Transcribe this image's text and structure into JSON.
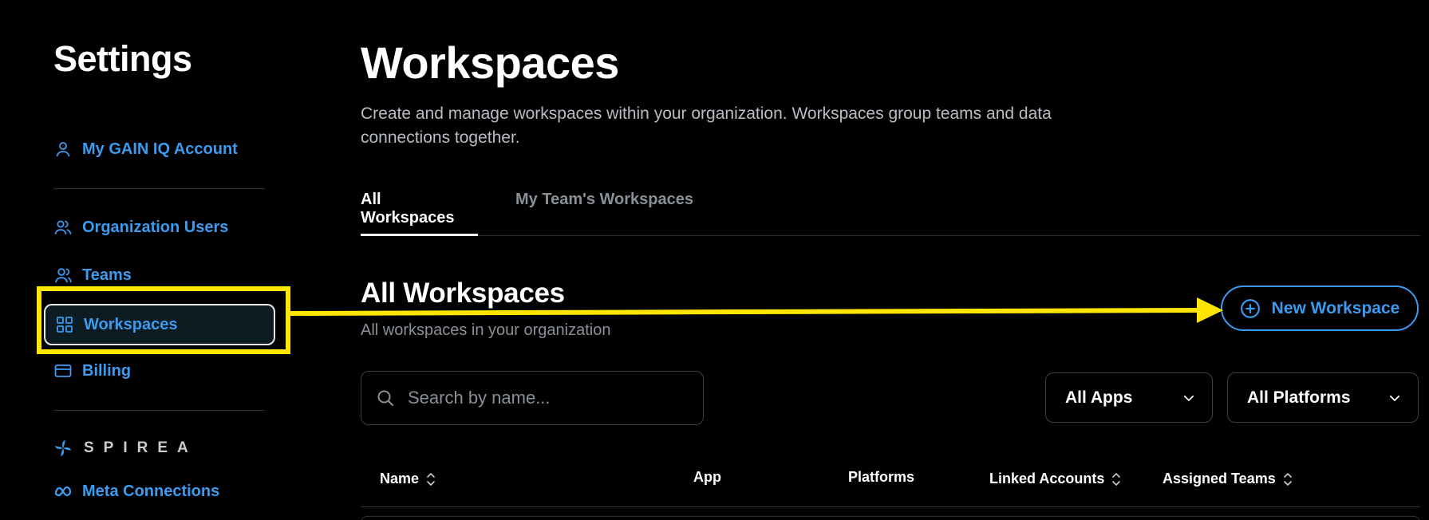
{
  "sidebar": {
    "title": "Settings",
    "items": [
      {
        "label": "My GAIN IQ Account",
        "icon": "user-icon"
      },
      {
        "label": "Organization Users",
        "icon": "users-icon"
      },
      {
        "label": "Teams",
        "icon": "team-icon"
      },
      {
        "label": "Workspaces",
        "icon": "grid-icon",
        "selected": true
      },
      {
        "label": "Billing",
        "icon": "credit-card-icon"
      }
    ],
    "brand": {
      "name": "SPIREA",
      "icon": "spirea-logo-icon"
    },
    "brand_items": [
      {
        "label": "Meta Connections",
        "icon": "meta-icon"
      }
    ]
  },
  "main": {
    "title": "Workspaces",
    "description": "Create and manage workspaces within your organization. Workspaces group teams and data connections together.",
    "tabs": [
      {
        "label": "All Workspaces",
        "active": true
      },
      {
        "label": "My Team's Workspaces",
        "active": false
      }
    ],
    "section": {
      "title": "All Workspaces",
      "subtitle": "All workspaces in your organization"
    },
    "new_button": {
      "label": "New Workspace",
      "icon": "plus-circle-icon"
    },
    "search": {
      "placeholder": "Search by name...",
      "value": "",
      "icon": "search-icon"
    },
    "filters": [
      {
        "selected": "All Apps",
        "icon": "chevron-down-icon"
      },
      {
        "selected": "All Platforms",
        "icon": "chevron-down-icon"
      }
    ],
    "table": {
      "columns": [
        {
          "label": "Name",
          "sortable": true
        },
        {
          "label": "App",
          "sortable": false
        },
        {
          "label": "Platforms",
          "sortable": false
        },
        {
          "label": "Linked Accounts",
          "sortable": true
        },
        {
          "label": "Assigned Teams",
          "sortable": true
        }
      ]
    }
  },
  "colors": {
    "background": "#000000",
    "accent": "#3b9bf0",
    "highlight": "#ffe600",
    "muted_text": "#8a9097"
  }
}
